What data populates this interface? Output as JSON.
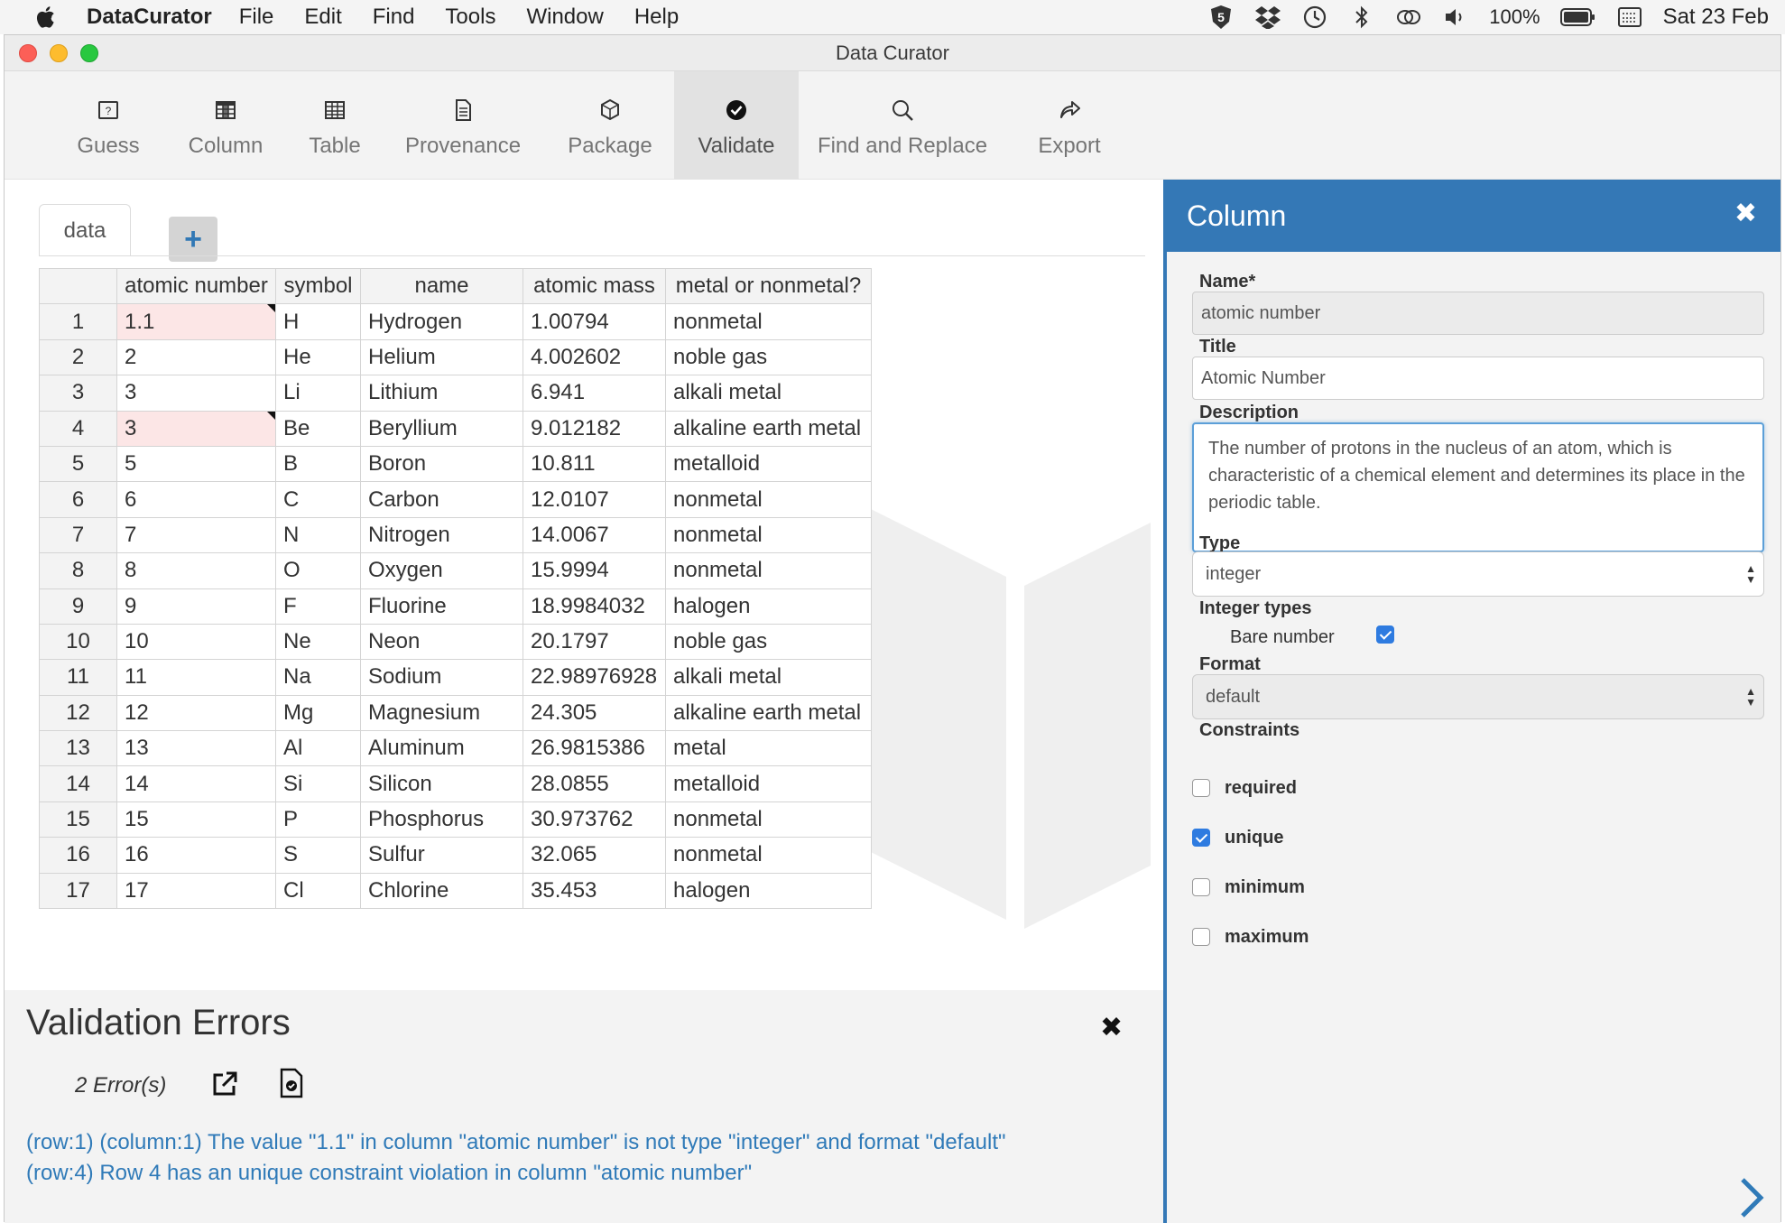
{
  "menubar": {
    "app_name": "DataCurator",
    "items": [
      "File",
      "Edit",
      "Find",
      "Tools",
      "Window",
      "Help"
    ],
    "battery": "100%",
    "date": "Sat 23 Feb"
  },
  "window": {
    "title": "Data Curator"
  },
  "toolbar": {
    "buttons": [
      {
        "label": "Guess",
        "icon": "guess-icon"
      },
      {
        "label": "Column",
        "icon": "column-icon"
      },
      {
        "label": "Table",
        "icon": "table-icon"
      },
      {
        "label": "Provenance",
        "icon": "provenance-icon"
      },
      {
        "label": "Package",
        "icon": "package-icon"
      },
      {
        "label": "Validate",
        "icon": "validate-icon"
      },
      {
        "label": "Find and Replace",
        "icon": "search-icon"
      },
      {
        "label": "Export",
        "icon": "export-icon"
      }
    ],
    "active": "Validate"
  },
  "tabs": {
    "data_tab": "data",
    "add_tab": "+"
  },
  "table": {
    "headers": [
      "atomic number",
      "symbol",
      "name",
      "atomic mass",
      "metal or nonmetal?"
    ],
    "rows": [
      [
        "1",
        "1.1",
        "H",
        "Hydrogen",
        "1.00794",
        "nonmetal"
      ],
      [
        "2",
        "2",
        "He",
        "Helium",
        "4.002602",
        "noble gas"
      ],
      [
        "3",
        "3",
        "Li",
        "Lithium",
        "6.941",
        "alkali metal"
      ],
      [
        "4",
        "3",
        "Be",
        "Beryllium",
        "9.012182",
        "alkaline earth metal"
      ],
      [
        "5",
        "5",
        "B",
        "Boron",
        "10.811",
        "metalloid"
      ],
      [
        "6",
        "6",
        "C",
        "Carbon",
        "12.0107",
        "nonmetal"
      ],
      [
        "7",
        "7",
        "N",
        "Nitrogen",
        "14.0067",
        "nonmetal"
      ],
      [
        "8",
        "8",
        "O",
        "Oxygen",
        "15.9994",
        "nonmetal"
      ],
      [
        "9",
        "9",
        "F",
        "Fluorine",
        "18.9984032",
        "halogen"
      ],
      [
        "10",
        "10",
        "Ne",
        "Neon",
        "20.1797",
        "noble gas"
      ],
      [
        "11",
        "11",
        "Na",
        "Sodium",
        "22.98976928",
        "alkali metal"
      ],
      [
        "12",
        "12",
        "Mg",
        "Magnesium",
        "24.305",
        "alkaline earth metal"
      ],
      [
        "13",
        "13",
        "Al",
        "Aluminum",
        "26.9815386",
        "metal"
      ],
      [
        "14",
        "14",
        "Si",
        "Silicon",
        "28.0855",
        "metalloid"
      ],
      [
        "15",
        "15",
        "P",
        "Phosphorus",
        "30.973762",
        "nonmetal"
      ],
      [
        "16",
        "16",
        "S",
        "Sulfur",
        "32.065",
        "nonmetal"
      ],
      [
        "17",
        "17",
        "Cl",
        "Chlorine",
        "35.453",
        "halogen"
      ]
    ],
    "error_rows": [
      1,
      4
    ]
  },
  "validation": {
    "title": "Validation Errors",
    "count": "2 Error(s)",
    "errors": [
      "(row:1) (column:1) The value \"1.1\" in column \"atomic number\" is not type \"integer\" and format \"default\"",
      "(row:4) Row 4 has an unique constraint violation in column \"atomic number\""
    ]
  },
  "panel": {
    "title": "Column",
    "name_label": "Name*",
    "name_value": "atomic number",
    "title_label": "Title",
    "title_value": "Atomic Number",
    "description_label": "Description",
    "description_value": "The number of protons in the nucleus of an atom, which is characteristic of a chemical element and determines its place in the periodic table.",
    "type_label": "Type",
    "type_value": "integer",
    "integer_types_label": "Integer types",
    "bare_number_label": "Bare number",
    "bare_number_checked": true,
    "format_label": "Format",
    "format_value": "default",
    "constraints_label": "Constraints",
    "constraints": [
      {
        "label": "required",
        "checked": false
      },
      {
        "label": "unique",
        "checked": true
      },
      {
        "label": "minimum",
        "checked": false
      },
      {
        "label": "maximum",
        "checked": false
      }
    ]
  },
  "colors": {
    "accent": "#3478b6",
    "error_cell": "#fce6e6",
    "error_text": "#2f7ab8",
    "checkbox": "#2e7be0"
  }
}
